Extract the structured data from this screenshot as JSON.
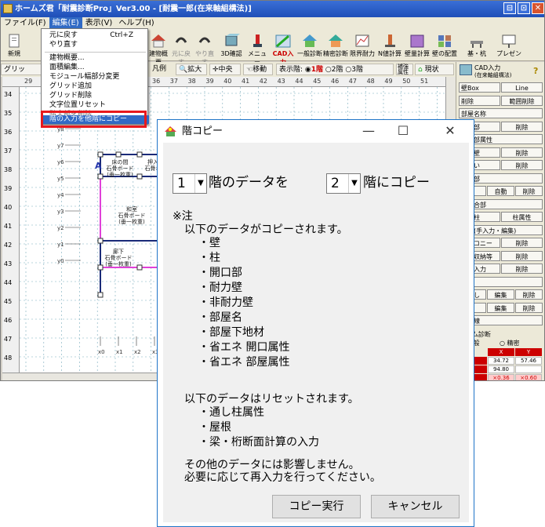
{
  "window": {
    "title": "ホームズ君「耐震診断Pro」Ver3.00 - [耐震一郎(在来軸組構法)]",
    "buttons": [
      "⊟",
      "⊡",
      "✕"
    ]
  },
  "menubar": {
    "items": [
      "ファイル(F)",
      "編集(E)",
      "表示(V)",
      "ヘルプ(H)"
    ]
  },
  "toolbar": {
    "buttons": [
      "新規",
      "建物概要",
      "元に戻す",
      "やり直す",
      "3D確認",
      "メニュー",
      "CAD入力",
      "一般診断",
      "精密診断",
      "限界耐力",
      "N値計算",
      "壁量計算",
      "壁の配置",
      "基・杭",
      "プレゼン"
    ]
  },
  "statusbar2": {
    "grid_label": "グリッド:1/",
    "legend": "凡例",
    "zoom": "拡大",
    "center": "中央",
    "move": "移動",
    "floor_label": "表示階:",
    "floor1": "1階",
    "floor2": "2階",
    "floor3": "3階",
    "reinforce": "補強\n属性",
    "status": "現状"
  },
  "ruler": {
    "top": [
      "29",
      "36",
      "37",
      "38",
      "39",
      "40",
      "41",
      "42",
      "43",
      "44",
      "45",
      "46",
      "47",
      "48",
      "49",
      "50",
      "51"
    ],
    "left": [
      "34",
      "35",
      "36",
      "37",
      "38",
      "39",
      "40",
      "41",
      "42",
      "43",
      "44",
      "45",
      "46",
      "47",
      "48"
    ]
  },
  "canvas": {
    "grid_y": [
      "y9",
      "y8",
      "y7",
      "y6",
      "y5",
      "y4",
      "y3",
      "y2",
      "y1",
      "y0"
    ],
    "grid_x": [
      "x0",
      "x1",
      "x2",
      "x3"
    ],
    "room1": [
      "床の間",
      "石骨ボード",
      "(垂一枚重)"
    ],
    "room2": [
      "押入",
      "石骨ボ"
    ],
    "room3": [
      "和室",
      "石骨ボード",
      "(垂一枚重)"
    ],
    "room4": [
      "廊下",
      "石骨ボード",
      "(垂一枚重)"
    ],
    "mark": "A"
  },
  "editmenu": {
    "items": [
      {
        "label": "元に戻す",
        "shortcut": "Ctrl+Z"
      },
      {
        "label": "やり直す",
        "shortcut": ""
      },
      {
        "label": "建物概要...",
        "shortcut": ""
      },
      {
        "label": "面積編集...",
        "shortcut": ""
      },
      {
        "label": "モジュール幅部分変更",
        "shortcut": ""
      },
      {
        "label": "グリッド追加",
        "shortcut": ""
      },
      {
        "label": "グリッド削除",
        "shortcut": ""
      },
      {
        "label": "文字位置リセット",
        "shortcut": ""
      },
      {
        "label": "階全部を削除",
        "shortcut": ""
      },
      {
        "label": "階の入力を他階にコピー",
        "shortcut": ""
      }
    ]
  },
  "rightpanel": {
    "cad_label": "CAD入力",
    "cad_sub": "(在来軸組構法)",
    "help": "?",
    "rows": [
      [
        "壁Box",
        "Line"
      ],
      [
        "削除",
        "範囲削除"
      ],
      [
        "部屋名称",
        ""
      ],
      [
        "開口部",
        "削除"
      ],
      [
        "開口部属性",
        ""
      ],
      [
        "耐力壁",
        "削除"
      ],
      [
        "筋かい",
        "削除"
      ],
      [
        "接合部",
        ""
      ],
      [
        "柱",
        "自動",
        "削除"
      ],
      [
        "柱接合部",
        ""
      ],
      [
        "通し柱",
        "柱属性"
      ],
      [
        "屋根(手入力・編集)",
        ""
      ],
      [
        "バルコニー",
        "削除"
      ],
      [
        "屋裏収納等",
        "削除"
      ],
      [
        "部分入力",
        "削除"
      ],
      [
        "編集",
        ""
      ],
      [
        "吹出し",
        "編集",
        "削除"
      ],
      [
        "画像",
        "編集",
        "削除"
      ],
      [
        "寸法線",
        ""
      ]
    ],
    "realtime_title": "タイム診断",
    "radio_general": "一般",
    "radio_precise": "精密",
    "table_head": [
      "X",
      "Y"
    ],
    "table_rows": [
      [
        "耐力",
        "34.72",
        "57.46"
      ],
      [
        "耐力",
        "94.80",
        ""
      ],
      [
        "点",
        "×0.36",
        "×0.60"
      ]
    ],
    "scale": "910mm"
  },
  "dialog": {
    "title": "階コピー",
    "from_floor": "1",
    "text_mid": "階のデータを",
    "to_floor": "2",
    "text_end": "階にコピー",
    "note_head": "※注",
    "copied_intro": "以下のデータがコピーされます。",
    "copied_items": [
      "・壁",
      "・柱",
      "・開口部",
      "・耐力壁",
      "・非耐力壁",
      "・部屋名",
      "・部屋下地材",
      "・省エネ 開口属性",
      "・省エネ 部屋属性"
    ],
    "reset_intro": "以下のデータはリセットされます。",
    "reset_items": [
      "・通し柱属性",
      "・屋根",
      "・梁・桁断面計算の入力"
    ],
    "footer1": "その他のデータには影響しません。",
    "footer2": "必要に応じて再入力を行ってください。",
    "btn_execute": "コピー実行",
    "btn_cancel": "キャンセル",
    "minimize": "—",
    "maximize": "☐",
    "close": "✕"
  },
  "colors": {
    "titlebar": "#2a5fcb",
    "highlight": "#316ac5",
    "callout": "#e8191d",
    "wall_navy": "#1a2a78",
    "wall_pink": "#e040d8"
  }
}
